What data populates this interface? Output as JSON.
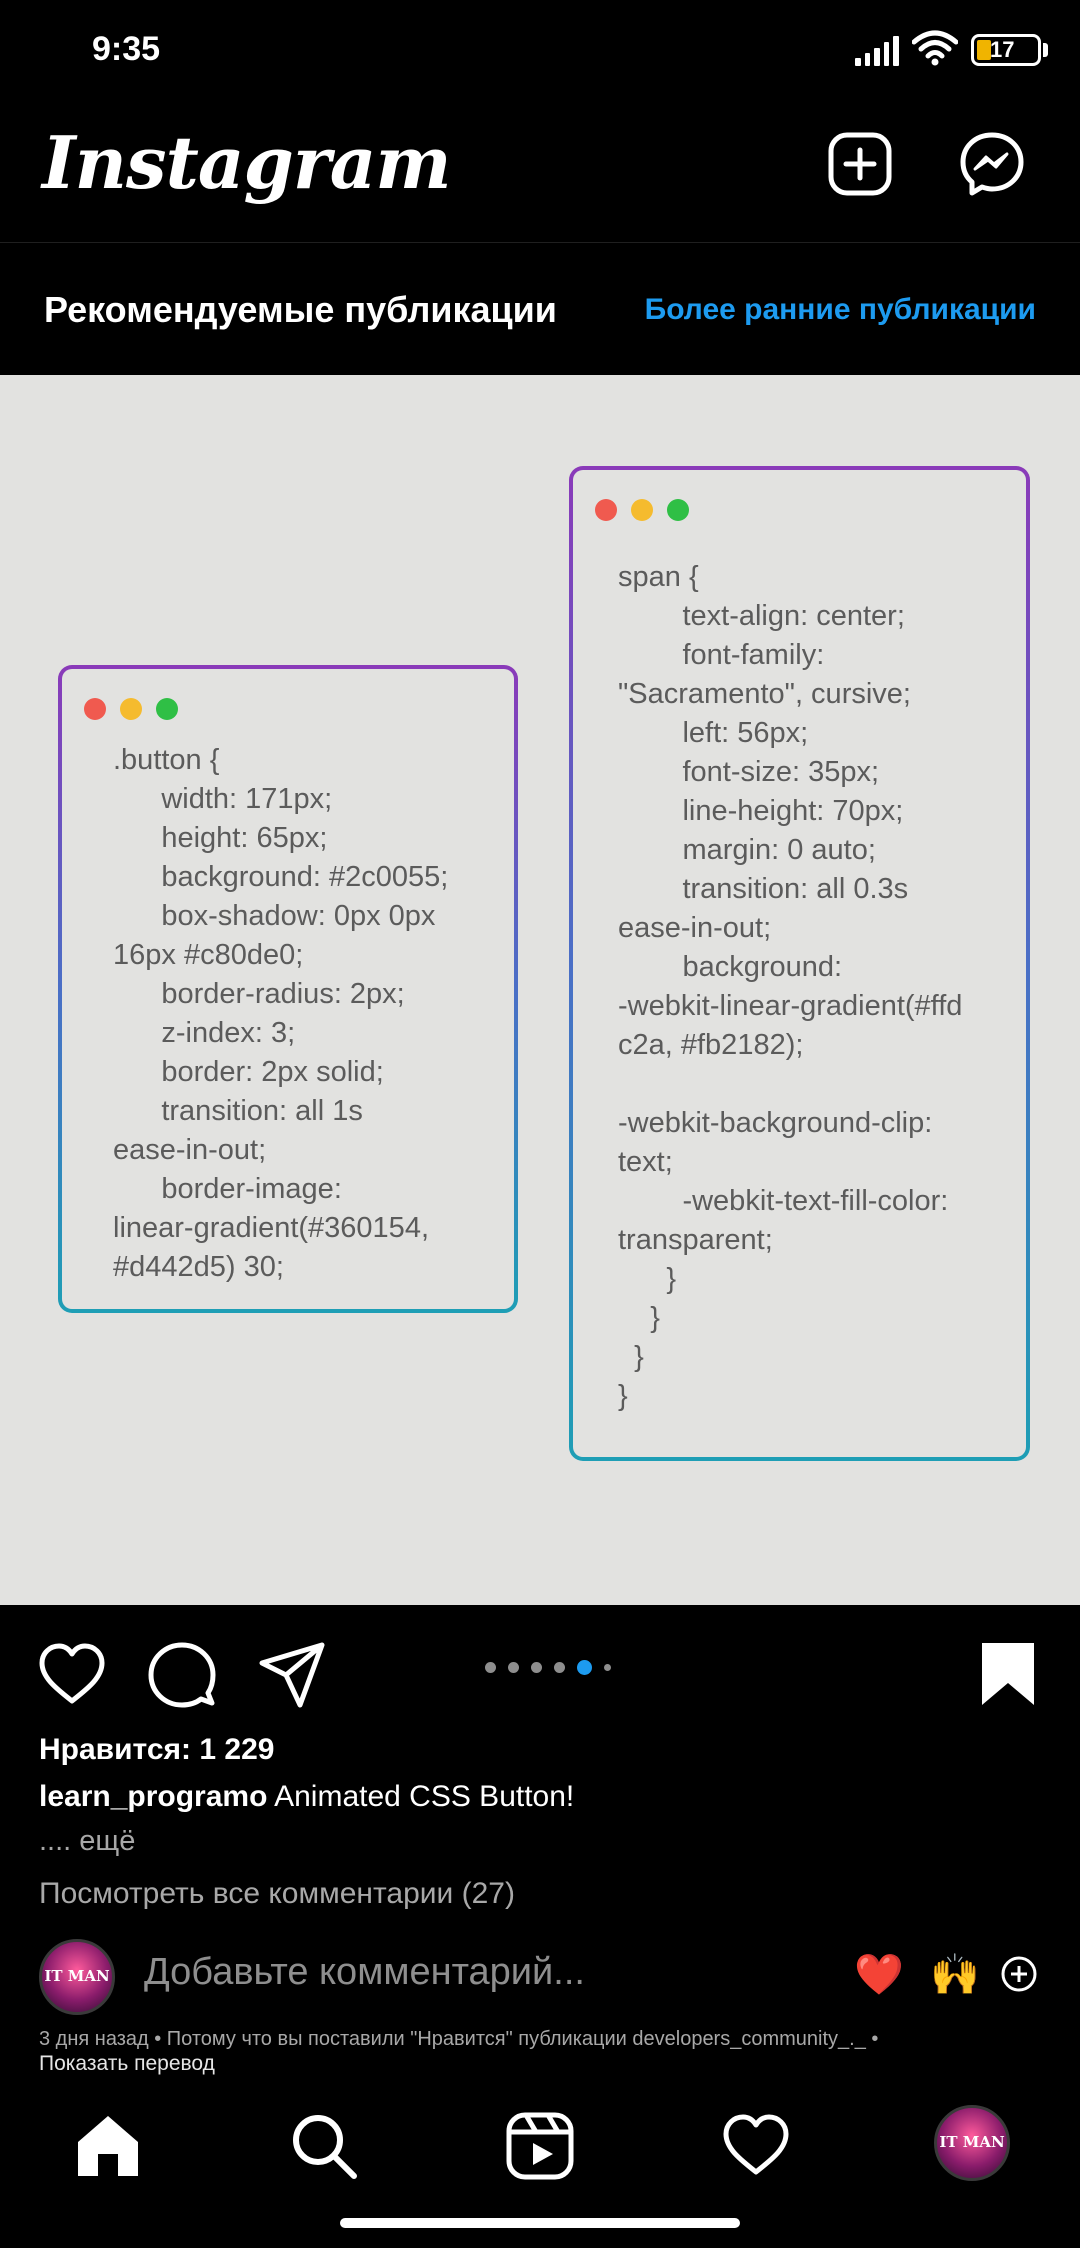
{
  "status_bar": {
    "time": "9:35",
    "battery": "17"
  },
  "app_bar": {
    "logo": "Instagram"
  },
  "suggested": {
    "title": "Рекомендуемые публикации",
    "older_link": "Более ранние публикации"
  },
  "post_image": {
    "left_card": {
      "code": ".button {\n      width: 171px;\n      height: 65px;\n      background: #2c0055;\n      box-shadow: 0px 0px\n16px #c80de0;\n      border-radius: 2px;\n      z-index: 3;\n      border: 2px solid;\n      transition: all 1s\nease-in-out;\n      border-image:\nlinear-gradient(#360154,\n#d442d5) 30;"
    },
    "right_card": {
      "code": "span {\n        text-align: center;\n        font-family:\n\"Sacramento\", cursive;\n        left: 56px;\n        font-size: 35px;\n        line-height: 70px;\n        margin: 0 auto;\n        transition: all 0.3s\nease-in-out;\n        background:\n-webkit-linear-gradient(#ffd\nc2a, #fb2182);\n\n-webkit-background-clip:\ntext;\n        -webkit-text-fill-color:\ntransparent;\n      }\n    }\n  }\n}"
    },
    "window_dot_colors": [
      "#f05a4f",
      "#f5bb2e",
      "#2fbf45"
    ],
    "card_gradient": [
      "#8a3ab9",
      "#1e9eb5"
    ]
  },
  "post": {
    "likes": "Нравится: 1 229",
    "username": "learn_programo",
    "caption": "Animated CSS Button!",
    "more": ".... ещё",
    "view_comments": "Посмотреть все комментарии (27)",
    "carousel": {
      "count": 6,
      "active_index": 4
    }
  },
  "comment": {
    "avatar_text": "IT MAN",
    "placeholder": "Добавьте комментарий...",
    "emoji_1": "❤️",
    "emoji_2": "🙌"
  },
  "meta": {
    "info": "3 дня назад • Потому что вы поставили \"Нравится\" публикации developers_community_._ •",
    "translate": "Показать перевод"
  },
  "colors": {
    "link_blue": "#1d9bf0",
    "image_bg": "#e2e2e0"
  }
}
